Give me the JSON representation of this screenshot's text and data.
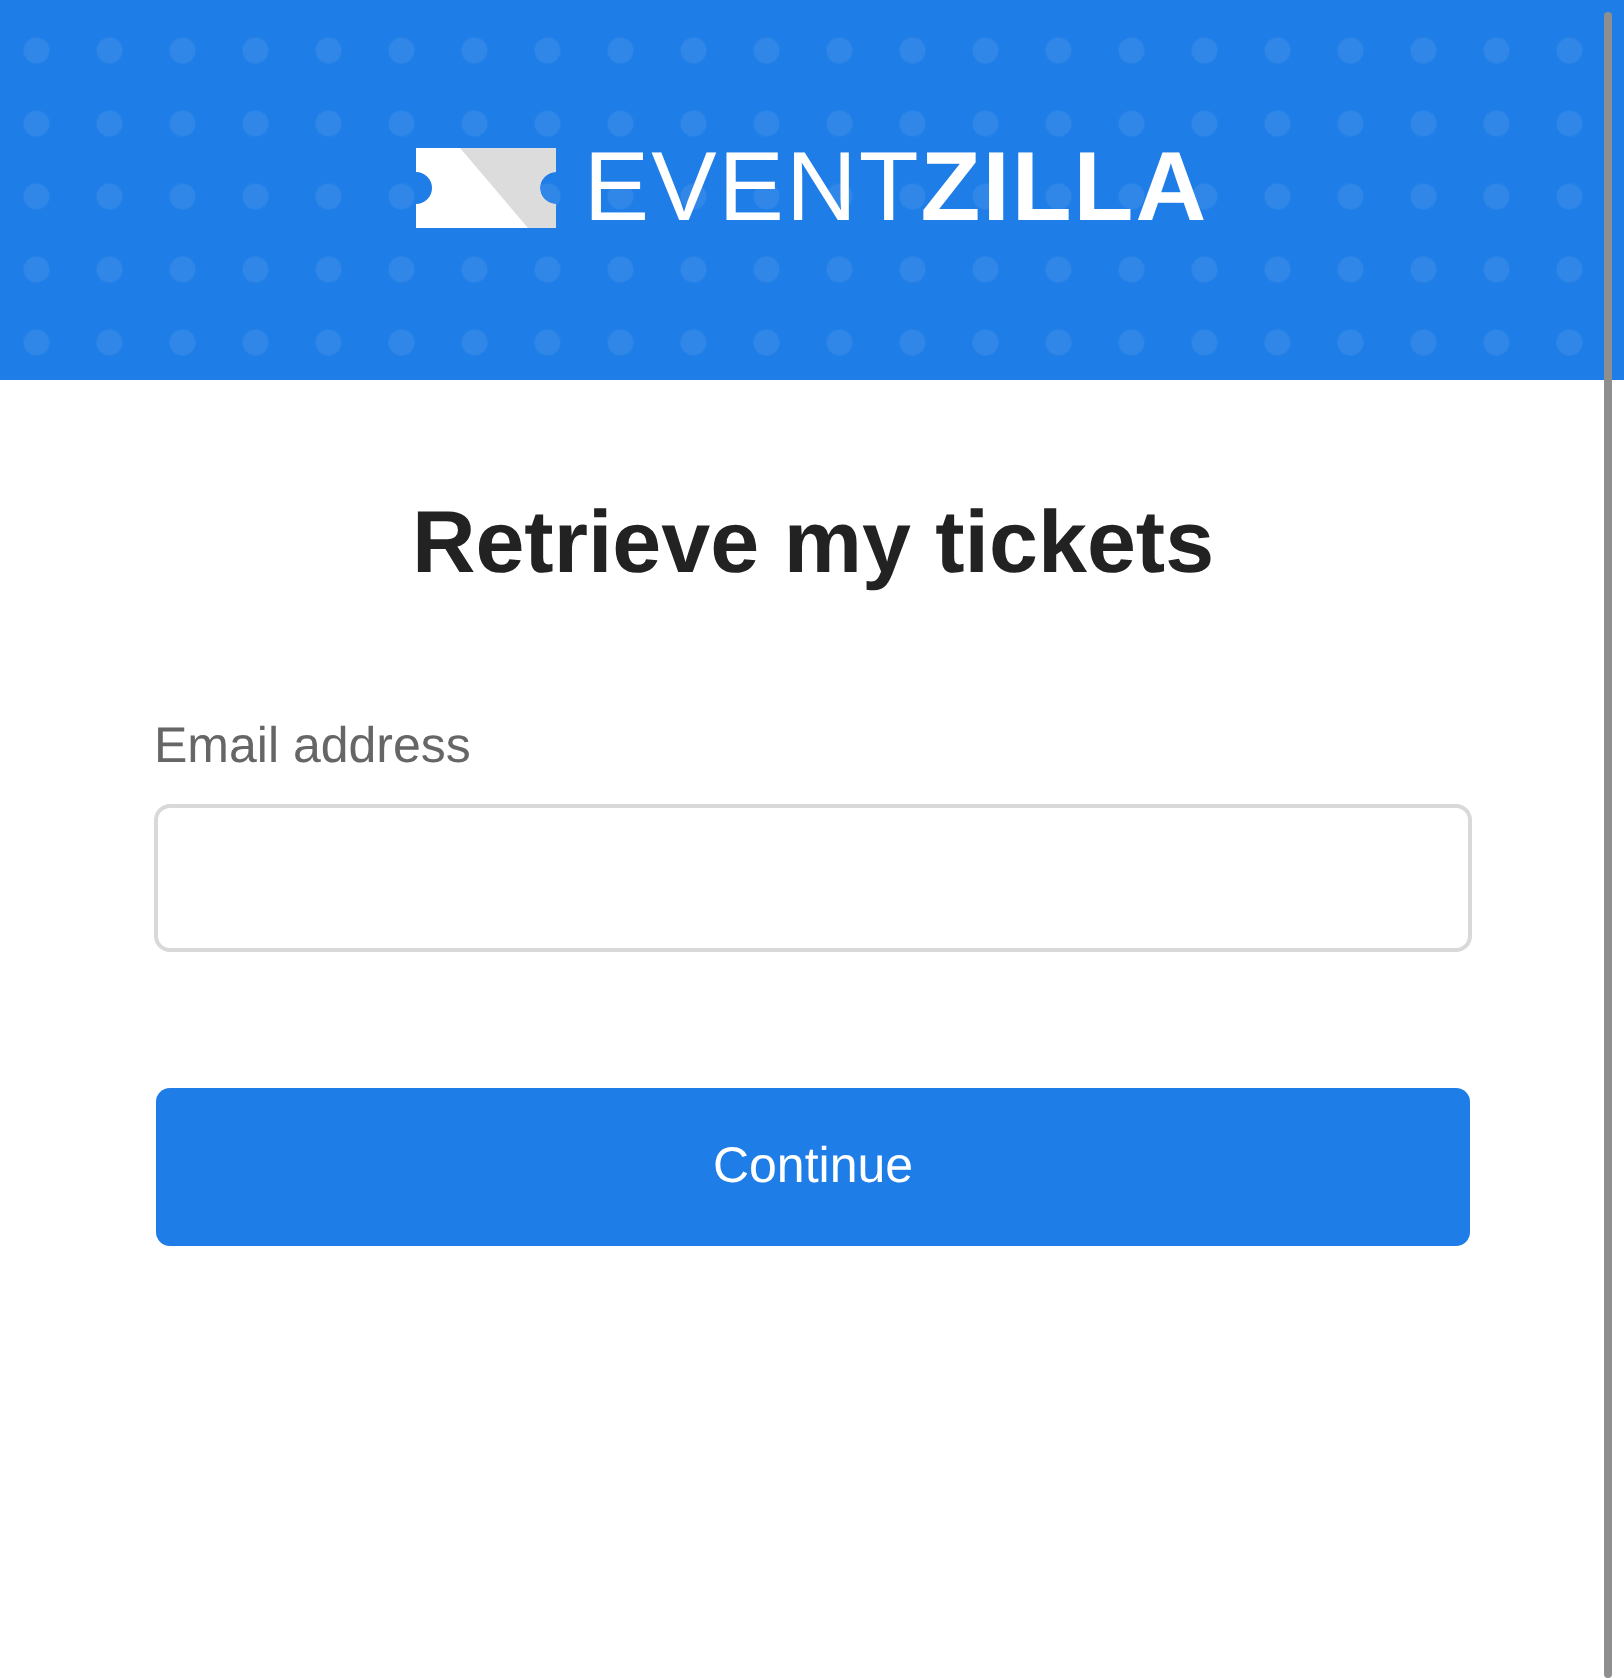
{
  "header": {
    "logo": "EVENT**ZILLA**"
  },
  "title": "Retrieve my tickets",
  "email_field": {
    "label": "Email address"
  },
  "button": "Continue"
}
